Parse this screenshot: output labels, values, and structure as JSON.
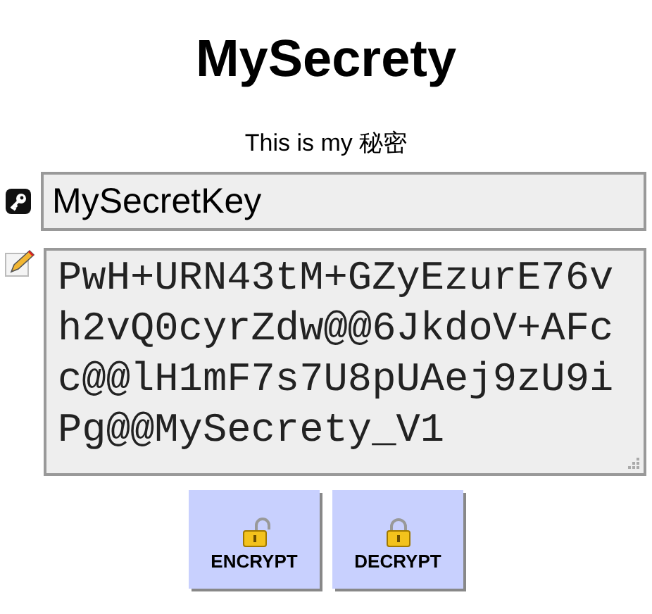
{
  "title": "MySecrety",
  "subtitle": "This is my 秘密",
  "key_field": {
    "value": "MySecretKey"
  },
  "text_field": {
    "value": "PwH+URN43tM+GZyEzurE76vh2vQ0cyrZdw@@6JkdoV+AFcc@@lH1mF7s7U8pUAej9zU9iPg@@MySecrety_V1"
  },
  "buttons": [
    {
      "label": "ENCRYPT",
      "kind": "encrypt"
    },
    {
      "label": "DECRYPT",
      "kind": "decrypt"
    }
  ]
}
